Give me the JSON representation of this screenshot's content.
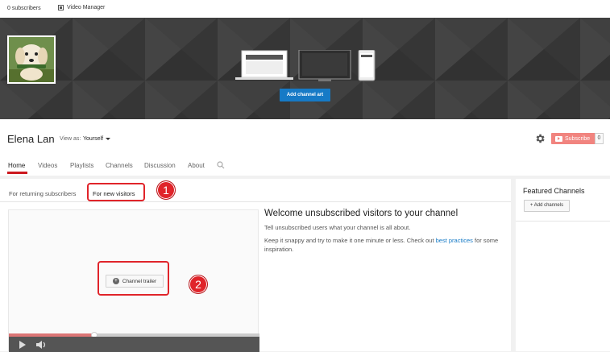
{
  "topbar": {
    "subscribers": "0 subscribers",
    "video_manager": "Video Manager"
  },
  "banner": {
    "add_art_label": "Add channel art"
  },
  "channel": {
    "name": "Elena Lan",
    "view_as_label": "View as:",
    "view_as_value": "Yourself"
  },
  "subscribe": {
    "label": "Subscribe",
    "count": "0"
  },
  "tabs": [
    {
      "label": "Home",
      "active": true
    },
    {
      "label": "Videos"
    },
    {
      "label": "Playlists"
    },
    {
      "label": "Channels"
    },
    {
      "label": "Discussion"
    },
    {
      "label": "About"
    }
  ],
  "subtabs": {
    "returning": "For returning subscribers",
    "new_visitors": "For new visitors"
  },
  "video": {
    "trailer_label": "Channel trailer",
    "progress_fraction": 0.34
  },
  "welcome": {
    "title": "Welcome unsubscribed visitors to your channel",
    "line1": "Tell unsubscribed users what your channel is all about.",
    "line2_pre": "Keep it snappy and try to make it one minute or less. Check out ",
    "line2_link": "best practices",
    "line2_post": " for some inspiration."
  },
  "featured": {
    "title": "Featured Channels",
    "add_label": "+ Add channels"
  },
  "annotations": {
    "badge1": "1",
    "badge2": "2"
  },
  "colors": {
    "accent_blue": "#167ac6",
    "youtube_red": "#e62117",
    "annotation_red": "#e0242a"
  },
  "icons": {
    "settings": "gear-icon",
    "search": "search-icon",
    "play": "play-icon",
    "volume": "volume-icon"
  }
}
